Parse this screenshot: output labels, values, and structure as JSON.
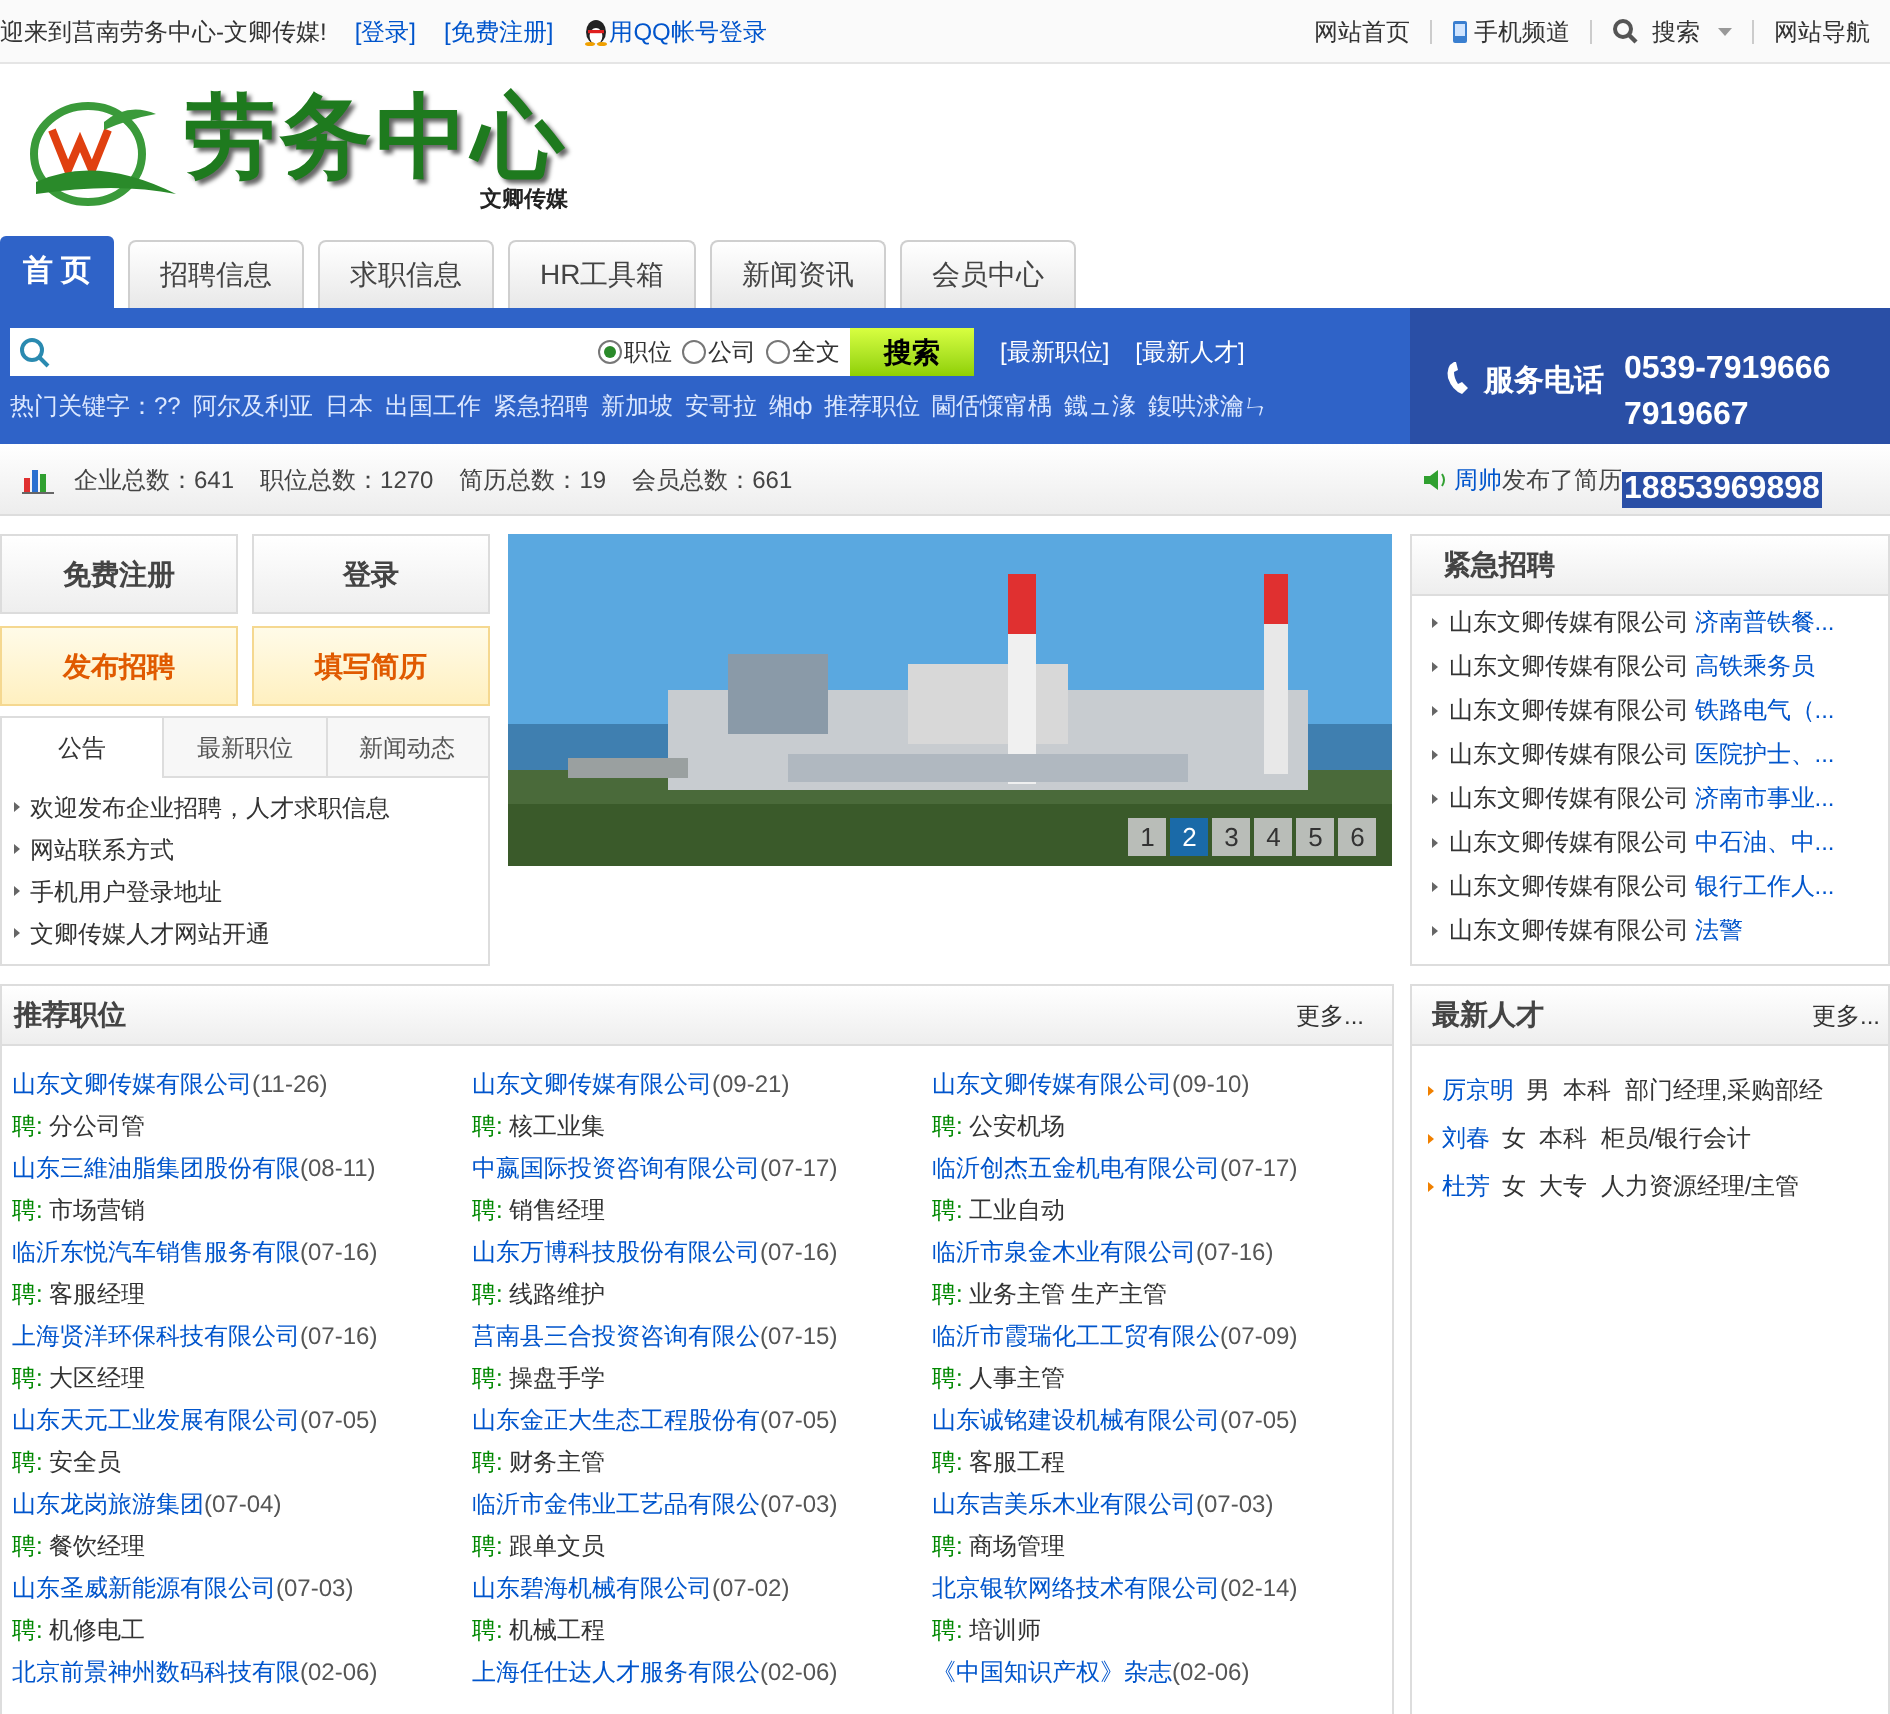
{
  "top_bar": {
    "welcome": "迎来到莒南劳务中心-文卿传媒!",
    "login": "[登录]",
    "register": "[免费注册]",
    "qq_login": "用QQ帐号登录",
    "links": [
      {
        "kind": "text",
        "label": "网站首页"
      },
      {
        "kind": "phone",
        "label": "手机频道"
      },
      {
        "kind": "search",
        "label": "搜索"
      },
      {
        "kind": "text",
        "label": "网站导航"
      }
    ]
  },
  "logo": {
    "title": "劳务中心",
    "subtitle": "文卿传媒"
  },
  "tabs": [
    {
      "label": "首 页",
      "selected": true
    },
    {
      "label": "招聘信息",
      "selected": false
    },
    {
      "label": "求职信息",
      "selected": false
    },
    {
      "label": "HR工具箱",
      "selected": false
    },
    {
      "label": "新闻资讯",
      "selected": false
    },
    {
      "label": "会员中心",
      "selected": false
    }
  ],
  "search": {
    "options": [
      {
        "label": "职位",
        "selected": true
      },
      {
        "label": "公司",
        "selected": false
      },
      {
        "label": "全文",
        "selected": false
      }
    ],
    "button": "搜索",
    "links": [
      "[最新职位]",
      "[最新人才]"
    ],
    "hot_label": "热门关键字：",
    "hot_keywords": [
      "??",
      "阿尔及利亚",
      "日本",
      "出国工作",
      "紧急招聘",
      "新加坡",
      "安哥拉",
      "缃ф",
      "推荐职位",
      "閫佸憡甯楀",
      "鐡ュ湪",
      "鍑哄浗瀹ㄣ"
    ]
  },
  "service": {
    "label": "服务电话",
    "phones": [
      "0539-7919666",
      "7919667",
      "18853969898"
    ]
  },
  "stats": {
    "items": [
      "企业总数：641",
      "职位总数：1270",
      "简历总数：19",
      "会员总数：661"
    ],
    "news_name": "周帅",
    "news_text": "发布了简历"
  },
  "quick_buttons": [
    {
      "label": "免费注册",
      "kind": "plain"
    },
    {
      "label": "登录",
      "kind": "plain"
    },
    {
      "label": "发布招聘",
      "kind": "accent"
    },
    {
      "label": "填写简历",
      "kind": "accent"
    }
  ],
  "notice_tabs": [
    {
      "label": "公告",
      "selected": true
    },
    {
      "label": "最新职位",
      "selected": false
    },
    {
      "label": "新闻动态",
      "selected": false
    }
  ],
  "notices": [
    "欢迎发布企业招聘，人才求职信息",
    "网站联系方式",
    "手机用户登录地址",
    "文卿传媒人才网站开通"
  ],
  "slideshow": {
    "kind": "picture",
    "pages": [
      {
        "label": "1",
        "selected": false
      },
      {
        "label": "2",
        "selected": true
      },
      {
        "label": "3",
        "selected": false
      },
      {
        "label": "4",
        "selected": false
      },
      {
        "label": "5",
        "selected": false
      },
      {
        "label": "6",
        "selected": false
      }
    ]
  },
  "urgent": {
    "title": "紧急招聘",
    "items": [
      {
        "company": "山东文卿传媒有限公司",
        "job": "济南普铁餐..."
      },
      {
        "company": "山东文卿传媒有限公司",
        "job": "高铁乘务员"
      },
      {
        "company": "山东文卿传媒有限公司",
        "job": "铁路电气（..."
      },
      {
        "company": "山东文卿传媒有限公司",
        "job": "医院护士、..."
      },
      {
        "company": "山东文卿传媒有限公司",
        "job": "济南市事业..."
      },
      {
        "company": "山东文卿传媒有限公司",
        "job": "中石油、中..."
      },
      {
        "company": "山东文卿传媒有限公司",
        "job": "银行工作人..."
      },
      {
        "company": "山东文卿传媒有限公司",
        "job": "法警"
      }
    ]
  },
  "recommended": {
    "title": "推荐职位",
    "more": "更多...",
    "items": [
      {
        "company": "山东文卿传媒有限公司",
        "date": "(11-26)",
        "prefix": "聘:",
        "job": "分公司管"
      },
      {
        "company": "山东文卿传媒有限公司",
        "date": "(09-21)",
        "prefix": "聘:",
        "job": "核工业集"
      },
      {
        "company": "山东文卿传媒有限公司",
        "date": "(09-10)",
        "prefix": "聘:",
        "job": "公安机场"
      },
      {
        "company": "山东三維油脂集团股份有限",
        "date": "(08-11)",
        "prefix": "聘:",
        "job": "市场营销"
      },
      {
        "company": "中嬴国际投资咨询有限公司",
        "date": "(07-17)",
        "prefix": "聘:",
        "job": "销售经理"
      },
      {
        "company": "临沂创杰五金机电有限公司",
        "date": "(07-17)",
        "prefix": "聘:",
        "job": "工业自动"
      },
      {
        "company": "临沂东悦汽车销售服务有限",
        "date": "(07-16)",
        "prefix": "聘:",
        "job": "客服经理"
      },
      {
        "company": "山东万博科技股份有限公司",
        "date": "(07-16)",
        "prefix": "聘:",
        "job": "线路维护"
      },
      {
        "company": "临沂市泉金木业有限公司",
        "date": "(07-16)",
        "prefix": "聘:",
        "job": "业务主管 生产主管"
      },
      {
        "company": "上海贤洋环保科技有限公司",
        "date": "(07-16)",
        "prefix": "聘:",
        "job": "大区经理"
      },
      {
        "company": "莒南县三合投资咨询有限公",
        "date": "(07-15)",
        "prefix": "聘:",
        "job": "操盘手学"
      },
      {
        "company": "临沂市霞瑞化工工贸有限公",
        "date": "(07-09)",
        "prefix": "聘:",
        "job": "人事主管"
      },
      {
        "company": "山东天元工业发展有限公司",
        "date": "(07-05)",
        "prefix": "聘:",
        "job": "安全员"
      },
      {
        "company": "山东金正大生态工程股份有",
        "date": "(07-05)",
        "prefix": "聘:",
        "job": "财务主管"
      },
      {
        "company": "山东诚铭建设机械有限公司",
        "date": "(07-05)",
        "prefix": "聘:",
        "job": "客服工程"
      },
      {
        "company": "山东龙岗旅游集团",
        "date": "(07-04)",
        "prefix": "聘:",
        "job": "餐饮经理"
      },
      {
        "company": "临沂市金伟业工艺品有限公",
        "date": "(07-03)",
        "prefix": "聘:",
        "job": "跟单文员"
      },
      {
        "company": "山东吉美乐木业有限公司",
        "date": "(07-03)",
        "prefix": "聘:",
        "job": "商场管理"
      },
      {
        "company": "山东圣威新能源有限公司",
        "date": "(07-03)",
        "prefix": "聘:",
        "job": "机修电工"
      },
      {
        "company": "山东碧海机械有限公司",
        "date": "(07-02)",
        "prefix": "聘:",
        "job": "机械工程"
      },
      {
        "company": "北京银软网络技术有限公司",
        "date": "(02-14)",
        "prefix": "聘:",
        "job": "培训师"
      },
      {
        "company": "北京前景神州数码科技有限",
        "date": "(02-06)"
      },
      {
        "company": "上海任仕达人才服务有限公",
        "date": "(02-06)"
      },
      {
        "company": "《中国知识产权》杂志",
        "date": "(02-06)"
      }
    ]
  },
  "talents": {
    "title": "最新人才",
    "more": "更多...",
    "items": [
      {
        "name": "厉京明",
        "details": "男  本科  部门经理,采购部经"
      },
      {
        "name": "刘春",
        "details": "女  本科  柜员/银行会计"
      },
      {
        "name": "杜芳",
        "details": "女  大专  人力资源经理/主管"
      }
    ]
  }
}
